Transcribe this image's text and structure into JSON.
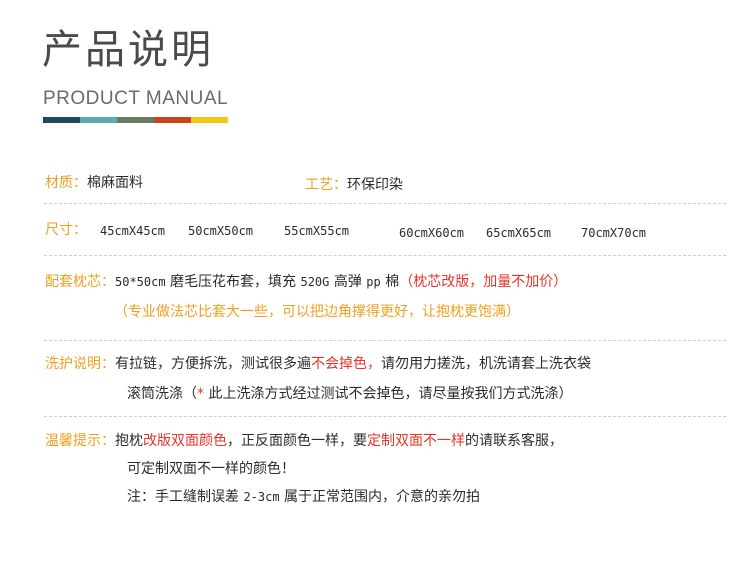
{
  "header": {
    "title_cn": "产品说明",
    "title_en": "PRODUCT MANUAL",
    "bar_colors": [
      "#1f4a5a",
      "#5faab0",
      "#6a7a5e",
      "#c7441c",
      "#f2c713"
    ]
  },
  "material": {
    "label": "材质：",
    "value": "棉麻面料"
  },
  "craft": {
    "label": "工艺：",
    "value": "环保印染"
  },
  "size": {
    "label": "尺寸：",
    "items": [
      "45cmX45cm",
      "50cmX50cm",
      "55cmX55cm",
      "60cmX60cm",
      "65cmX65cm",
      "70cmX70cm"
    ]
  },
  "core": {
    "label": "配套枕芯：",
    "line1_a": "50*50cm",
    "line1_b": "磨毛压花布套，填充",
    "line1_c": "520G",
    "line1_d": "高弹",
    "line1_e": "pp",
    "line1_f": "棉",
    "line1_red": "（枕芯改版，加量不加价）",
    "line2_red": "（专业做法芯比套大一些，可以把边角撑得更好，让抱枕更饱满）"
  },
  "wash": {
    "label": "洗护说明：",
    "line1_a": "有拉链，方便拆洗，测试很多遍",
    "line1_red": "不会掉色，",
    "line1_b": "请勿用力搓洗，机洗请套上洗衣袋",
    "line2_a": "滚筒洗涤（",
    "line2_star": "*",
    "line2_b": "此上洗涤方式经过测试不会掉色，请尽量按我们方式洗涤）"
  },
  "notice": {
    "label": "温馨提示：",
    "line1_a": "抱枕",
    "line1_red1": "改版双面颜色",
    "line1_b": "，正反面颜色一样，要",
    "line1_red2": "定制双面不一样",
    "line1_c": "的请联系客服，",
    "line2": "可定制双面不一样的颜色！",
    "line3_a": "注：手工缝制误差",
    "line3_b": "2-3cm",
    "line3_c": "属于正常范围内，介意的亲勿拍"
  }
}
